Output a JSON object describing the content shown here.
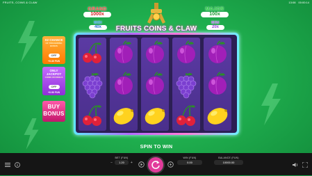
{
  "topbar": {
    "game_title": "FRUITS, COINS & CLAW",
    "time": "13:08",
    "session": "00:00:14"
  },
  "jackpots": {
    "grand": {
      "name": "GRAND",
      "value": "1000x"
    },
    "major": {
      "name": "MAJOR",
      "value": "100x"
    },
    "midi": {
      "name": "MIDI",
      "value": "40x"
    },
    "mini": {
      "name": "MINI",
      "value": "20x"
    }
  },
  "logo": {
    "text": "FRUITS COINS & CLAW"
  },
  "side_panels": {
    "x2_chance": {
      "title": "X2 CHANCE",
      "subtitle": "OF TRIGGERING BONUS",
      "toggle": "OFF",
      "cost": "+0.30 FUN"
    },
    "only_jackpot": {
      "title": "ONLY JACKPOT",
      "subtitle": "COINS ON REELS",
      "toggle": "OFF",
      "cost": "+0.90 FUN"
    },
    "buy_bonus": {
      "line1": "BUY",
      "line2": "BONUS"
    }
  },
  "reels": [
    [
      "cherry",
      "grape",
      "cherry"
    ],
    [
      "plum",
      "plum",
      "lemon"
    ],
    [
      "plum",
      "plum",
      "lemon"
    ],
    [
      "plum",
      "grape",
      "cherry"
    ],
    [
      "plum",
      "plum",
      "lemon"
    ]
  ],
  "symbols": {
    "cherry": {
      "primary": "#e0213a",
      "secondary": "#ff6b7d",
      "stem": "#2d8a2d"
    },
    "grape": {
      "primary": "#7b3fd0",
      "secondary": "#b48af0",
      "stem": "#2d8a2d"
    },
    "plum": {
      "primary": "#a11fb8",
      "secondary": "#e06be8",
      "stem": "#2d8a2d"
    },
    "lemon": {
      "primary": "#ffd21f",
      "secondary": "#fff27a",
      "stem": "#c79a00"
    }
  },
  "status": {
    "message": "SPIN TO WIN"
  },
  "bottom": {
    "bet": {
      "label": "BET (FUN)",
      "value": "1.20"
    },
    "win": {
      "label": "WIN (FUN)",
      "value": "0.00"
    },
    "balance": {
      "label": "BALANCE (FUN)",
      "value": "10000.00"
    }
  },
  "colors": {
    "background": "#1fae4e",
    "spin_button": "#e23b9b",
    "bottom_bar": "#151515"
  }
}
